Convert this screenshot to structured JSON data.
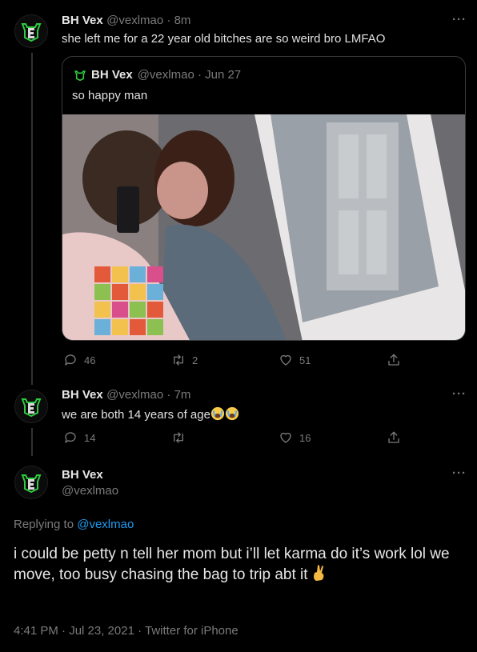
{
  "tweet1": {
    "name": "BH Vex",
    "handle_time": "@vexlmao · 8m",
    "text": "she left me for a 22 year old bitches are so weird bro LMFAO",
    "more": "···",
    "quote": {
      "name": "BH Vex",
      "handle_time": "@vexlmao · Jun 27",
      "text": "so happy man"
    },
    "actions": {
      "reply": "46",
      "retweet": "2",
      "like": "51"
    }
  },
  "tweet2": {
    "name": "BH Vex",
    "handle_time": "@vexlmao · 7m",
    "text": "we are both 14 years of age",
    "more": "···",
    "actions": {
      "reply": "14",
      "retweet": "",
      "like": "16"
    }
  },
  "tweet3": {
    "name": "BH Vex",
    "handle": "@vexlmao",
    "more": "···",
    "replying_prefix": "Replying to ",
    "replying_handle": "@vexlmao",
    "text": "i could be petty n tell her mom but i’ll let karma do it’s work lol we move, too busy chasing the bag to trip abt it",
    "meta": "4:41 PM · Jul 23, 2021 · Twitter for iPhone"
  },
  "colors": {
    "background": "#000000",
    "link": "#1d9bf0",
    "muted": "#7a7a7a",
    "brand_green": "#2ecc40"
  },
  "icons": [
    "reply-icon",
    "retweet-icon",
    "like-icon",
    "share-icon",
    "more-icon",
    "emoji-crying",
    "emoji-crossed-fingers"
  ]
}
